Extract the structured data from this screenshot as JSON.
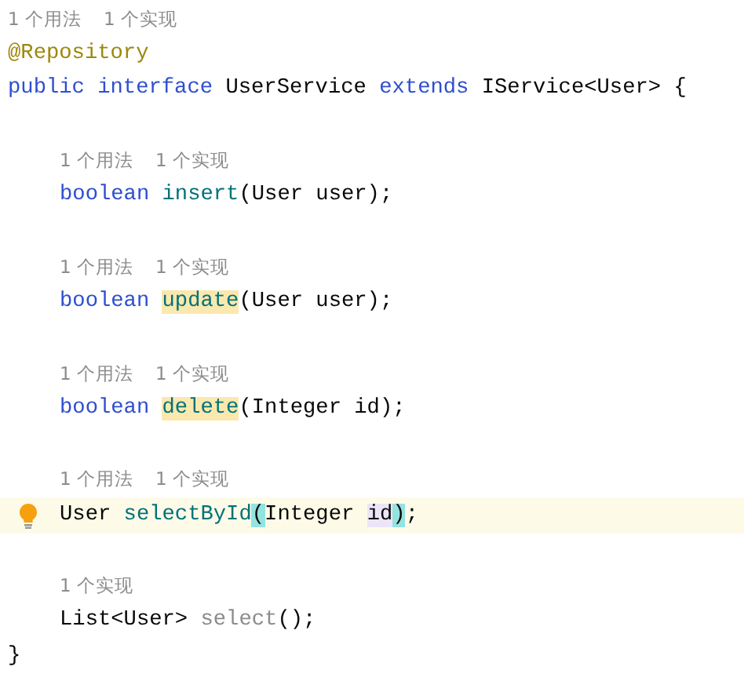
{
  "lines": [
    {
      "kind": "hint",
      "indented": false,
      "texts": [
        "1 个用法",
        "1 个实现"
      ]
    },
    {
      "kind": "code",
      "indented": false,
      "current": false,
      "tokens": [
        {
          "text": "@Repository",
          "kind": "annotation"
        }
      ]
    },
    {
      "kind": "code",
      "indented": false,
      "current": false,
      "tokens": [
        {
          "text": "public interface ",
          "kind": "keyword"
        },
        {
          "text": "UserService ",
          "kind": "plain"
        },
        {
          "text": "extends ",
          "kind": "keyword"
        },
        {
          "text": "IService<User> {",
          "kind": "plain"
        }
      ]
    },
    {
      "kind": "blank"
    },
    {
      "kind": "hint",
      "indented": true,
      "texts": [
        "1 个用法",
        "1 个实现"
      ]
    },
    {
      "kind": "code",
      "indented": true,
      "current": false,
      "tokens": [
        {
          "text": "boolean ",
          "kind": "keyword"
        },
        {
          "text": "insert",
          "kind": "method"
        },
        {
          "text": "(User user);",
          "kind": "plain"
        }
      ]
    },
    {
      "kind": "blank"
    },
    {
      "kind": "hint",
      "indented": true,
      "texts": [
        "1 个用法",
        "1 个实现"
      ]
    },
    {
      "kind": "code",
      "indented": true,
      "current": false,
      "tokens": [
        {
          "text": "boolean ",
          "kind": "keyword"
        },
        {
          "text": "update",
          "kind": "method",
          "color": "#fbe8ae"
        },
        {
          "text": "(User user);",
          "kind": "plain"
        }
      ]
    },
    {
      "kind": "blank"
    },
    {
      "kind": "hint",
      "indented": true,
      "texts": [
        "1 个用法",
        "1 个实现"
      ]
    },
    {
      "kind": "code",
      "indented": true,
      "current": false,
      "tokens": [
        {
          "text": "boolean ",
          "kind": "keyword"
        },
        {
          "text": "delete",
          "kind": "method",
          "color": "#fbe8ae"
        },
        {
          "text": "(Integer id);",
          "kind": "plain"
        }
      ]
    },
    {
      "kind": "blank"
    },
    {
      "kind": "hint",
      "indented": true,
      "texts": [
        "1 个用法",
        "1 个实现"
      ]
    },
    {
      "kind": "code",
      "indented": true,
      "current": true,
      "tokens": [
        {
          "text": "User ",
          "kind": "plain"
        },
        {
          "text": "selectById",
          "kind": "method"
        },
        {
          "text": "(",
          "kind": "plain",
          "color": "#93e3e0"
        },
        {
          "text": "Integer ",
          "kind": "plain"
        },
        {
          "text": "id",
          "kind": "plain",
          "color": "#ece5f8"
        },
        {
          "text": ")",
          "kind": "plain",
          "color": "#93e3e0"
        },
        {
          "text": ";",
          "kind": "plain"
        }
      ]
    },
    {
      "kind": "blank"
    },
    {
      "kind": "hint",
      "indented": true,
      "texts": [
        "1 个实现"
      ]
    },
    {
      "kind": "code",
      "indented": true,
      "current": false,
      "tokens": [
        {
          "text": "List<User> ",
          "kind": "plain"
        },
        {
          "text": "select",
          "kind": "unused"
        },
        {
          "text": "();",
          "kind": "plain"
        }
      ]
    },
    {
      "kind": "code",
      "indented": false,
      "current": false,
      "tokens": [
        {
          "text": "}",
          "kind": "plain"
        }
      ]
    }
  ]
}
